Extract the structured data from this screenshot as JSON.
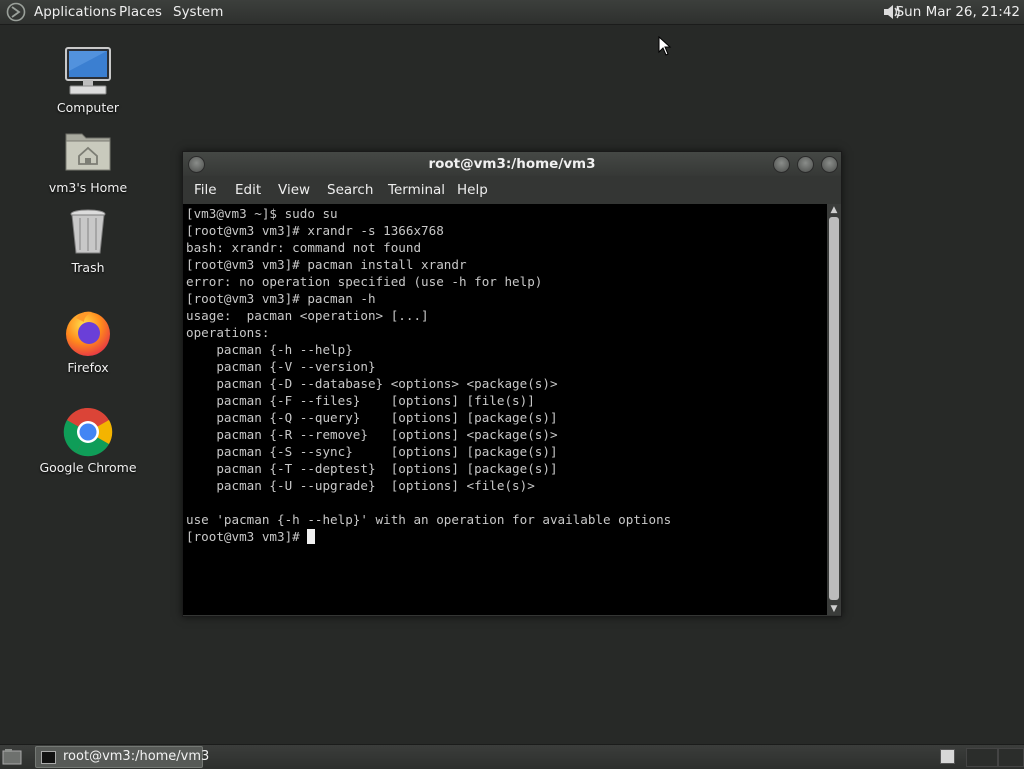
{
  "top_panel": {
    "menus": [
      "Applications",
      "Places",
      "System"
    ],
    "clock": "Sun Mar 26, 21:42",
    "volume_icon": "speaker-icon"
  },
  "desktop_icons": [
    {
      "label": "Computer",
      "icon": "computer-icon"
    },
    {
      "label": "vm3's Home",
      "icon": "home-folder-icon"
    },
    {
      "label": "Trash",
      "icon": "trash-icon"
    },
    {
      "label": "Firefox",
      "icon": "firefox-icon"
    },
    {
      "label": "Google Chrome",
      "icon": "chrome-icon"
    }
  ],
  "terminal": {
    "title": "root@vm3:/home/vm3",
    "menu": [
      "File",
      "Edit",
      "View",
      "Search",
      "Terminal",
      "Help"
    ],
    "lines": [
      "[vm3@vm3 ~]$ sudo su",
      "[root@vm3 vm3]# xrandr -s 1366x768",
      "bash: xrandr: command not found",
      "[root@vm3 vm3]# pacman install xrandr",
      "error: no operation specified (use -h for help)",
      "[root@vm3 vm3]# pacman -h",
      "usage:  pacman <operation> [...]",
      "operations:",
      "    pacman {-h --help}",
      "    pacman {-V --version}",
      "    pacman {-D --database} <options> <package(s)>",
      "    pacman {-F --files}    [options] [file(s)]",
      "    pacman {-Q --query}    [options] [package(s)]",
      "    pacman {-R --remove}   [options] <package(s)>",
      "    pacman {-S --sync}     [options] [package(s)]",
      "    pacman {-T --deptest}  [options] [package(s)]",
      "    pacman {-U --upgrade}  [options] <file(s)>",
      "",
      "use 'pacman {-h --help}' with an operation for available options"
    ],
    "prompt": "[root@vm3 vm3]# "
  },
  "taskbar": {
    "task_label": "root@vm3:/home/vm3"
  },
  "colors": {
    "desktop_bg": "#272927",
    "panel_bg": "#353735",
    "terminal_bg": "#000000",
    "terminal_fg": "#c8c8c8"
  }
}
